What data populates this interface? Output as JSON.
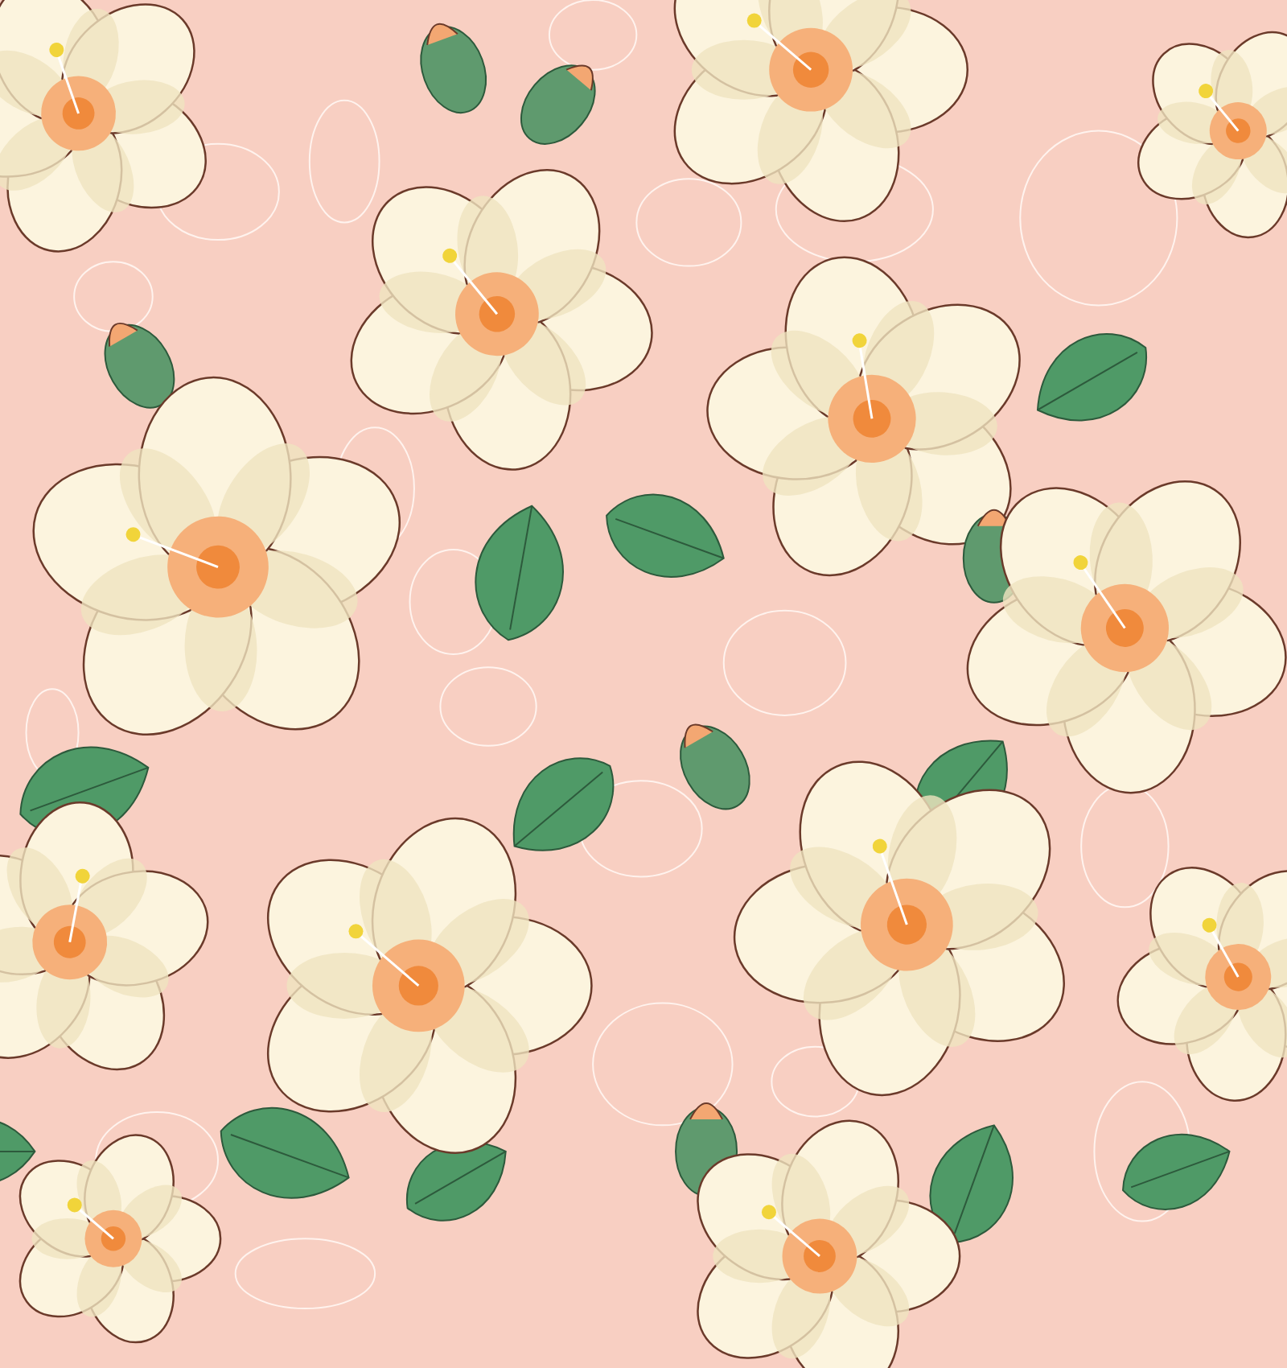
{
  "artwork": {
    "kind": "floral-pattern"
  }
}
